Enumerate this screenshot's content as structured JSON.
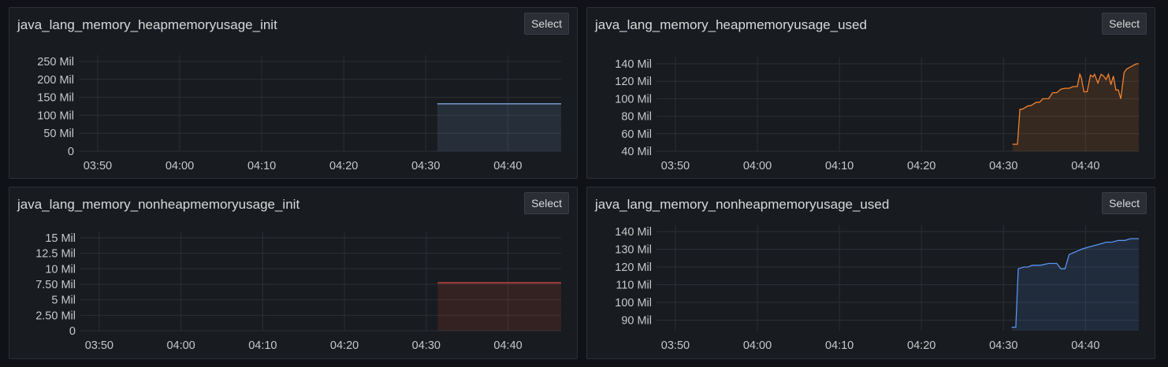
{
  "select_label": "Select",
  "panels": [
    {
      "title": "java_lang_memory_heapmemoryusage_init",
      "chart_data": {
        "type": "area",
        "color": "#7ea6da",
        "x_ticks": [
          "03:50",
          "04:00",
          "04:10",
          "04:20",
          "04:30",
          "04:40"
        ],
        "x_tick_minutes": [
          0,
          10,
          20,
          30,
          40,
          50
        ],
        "xlim": [
          -2.3,
          56.5
        ],
        "y_ticks": [
          "0",
          "50 Mil",
          "100 Mil",
          "150 Mil",
          "200 Mil",
          "250 Mil"
        ],
        "y_tick_values": [
          0,
          50,
          100,
          150,
          200,
          250
        ],
        "ylim": [
          0,
          250
        ],
        "grid": true,
        "series": [
          {
            "x": [
              41.4,
              56.5
            ],
            "y": [
              132,
              132
            ]
          }
        ]
      }
    },
    {
      "title": "java_lang_memory_heapmemoryusage_used",
      "chart_data": {
        "type": "area",
        "color": "#f2822e",
        "x_ticks": [
          "03:50",
          "04:00",
          "04:10",
          "04:20",
          "04:30",
          "04:40"
        ],
        "x_tick_minutes": [
          0,
          10,
          20,
          30,
          40,
          50
        ],
        "xlim": [
          -2.3,
          56.5
        ],
        "y_ticks": [
          "40 Mil",
          "60 Mil",
          "80 Mil",
          "100 Mil",
          "120 Mil",
          "140 Mil"
        ],
        "y_tick_values": [
          40,
          60,
          80,
          100,
          120,
          140
        ],
        "ylim": [
          40,
          140
        ],
        "grid": true,
        "series": [
          {
            "x": [
              41.1,
              41.7,
              42.0,
              42.3,
              43.0,
              43.3,
              44.0,
              44.4,
              44.8,
              45.5,
              46.0,
              46.5,
              47.0,
              47.5,
              48.0,
              48.5,
              49.0,
              49.3,
              49.5,
              49.8,
              50.2,
              50.6,
              50.9,
              51.1,
              51.5,
              51.9,
              52.2,
              52.5,
              52.8,
              53.1,
              53.4,
              53.7,
              54.0,
              54.3,
              54.7,
              55.0,
              55.4,
              55.8,
              56.2,
              56.5
            ],
            "y": [
              48,
              48,
              88,
              88,
              92,
              92,
              96,
              96,
              100,
              100,
              107,
              107,
              111,
              112,
              112,
              114,
              114,
              128,
              124,
              108,
              108,
              127,
              125,
              128,
              118,
              128,
              126,
              122,
              128,
              116,
              126,
              110,
              110,
              100,
              130,
              134,
              136,
              138,
              140,
              140
            ]
          }
        ]
      }
    },
    {
      "title": "java_lang_memory_nonheapmemoryusage_init",
      "chart_data": {
        "type": "area",
        "color": "#e24d42",
        "x_ticks": [
          "03:50",
          "04:00",
          "04:10",
          "04:20",
          "04:30",
          "04:40"
        ],
        "x_tick_minutes": [
          0,
          10,
          20,
          30,
          40,
          50
        ],
        "xlim": [
          -2.3,
          56.5
        ],
        "y_ticks": [
          "0",
          "2.50 Mil",
          "5 Mil",
          "7.50 Mil",
          "10 Mil",
          "12.5 Mil",
          "15 Mil"
        ],
        "y_tick_values": [
          0,
          2.5,
          5,
          7.5,
          10,
          12.5,
          15
        ],
        "ylim": [
          0,
          15
        ],
        "grid": true,
        "series": [
          {
            "x": [
              41.4,
              56.5
            ],
            "y": [
              7.75,
              7.75
            ]
          }
        ]
      }
    },
    {
      "title": "java_lang_memory_nonheapmemoryusage_used",
      "chart_data": {
        "type": "area",
        "color": "#5794f2",
        "x_ticks": [
          "03:50",
          "04:00",
          "04:10",
          "04:20",
          "04:30",
          "04:40"
        ],
        "x_tick_minutes": [
          0,
          10,
          20,
          30,
          40,
          50
        ],
        "xlim": [
          -2.3,
          56.5
        ],
        "y_ticks": [
          "90 Mil",
          "100 Mil",
          "110 Mil",
          "120 Mil",
          "130 Mil",
          "140 Mil"
        ],
        "y_tick_values": [
          90,
          100,
          110,
          120,
          130,
          140
        ],
        "ylim": [
          84,
          140
        ],
        "grid": true,
        "series": [
          {
            "x": [
              41.0,
              41.5,
              41.8,
              42.5,
              43.0,
              43.5,
              44.5,
              45.5,
              46.5,
              47.0,
              47.5,
              48.0,
              48.5,
              49.0,
              49.5,
              50.2,
              51.0,
              51.8,
              52.5,
              53.2,
              54.0,
              54.8,
              55.5,
              56.0,
              56.5
            ],
            "y": [
              86,
              86,
              119,
              120,
              120,
              121,
              121,
              122,
              122,
              119,
              119,
              127,
              128,
              129,
              130,
              131,
              132,
              133,
              134,
              134,
              135,
              135,
              136,
              136,
              136
            ]
          }
        ]
      }
    }
  ]
}
